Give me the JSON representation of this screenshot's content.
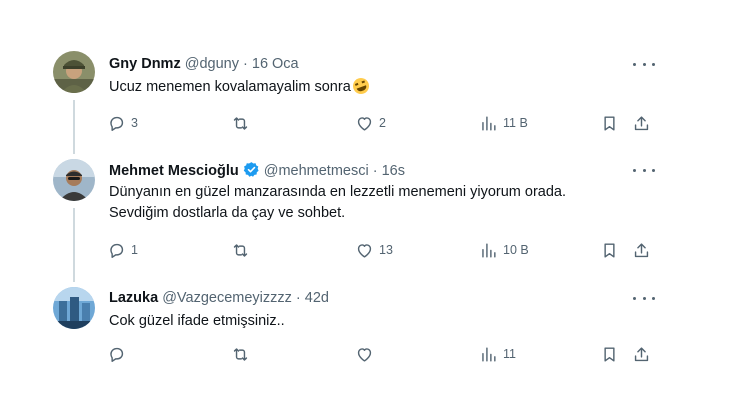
{
  "tweets": [
    {
      "name": "Gny Dnmz",
      "handle": "@dguny",
      "dot": "·",
      "time": "16 Oca",
      "verified": false,
      "text_lines": [
        "Ucuz menemen kovalamayalim sonra"
      ],
      "has_emoji": true,
      "emoji": "rolling-on-floor-laughing",
      "replies": "3",
      "retweets": "",
      "likes": "2",
      "views": "11 B"
    },
    {
      "name": "Mehmet Mescioğlu",
      "handle": "@mehmetmesci",
      "dot": "·",
      "time": "16s",
      "verified": true,
      "text_lines": [
        "Dünyanın en güzel manzarasında en lezzetli menemeni yiyorum orada.",
        "Sevdiğim dostlarla da çay ve sohbet."
      ],
      "replies": "1",
      "retweets": "",
      "likes": "13",
      "views": "10 B"
    },
    {
      "name": "Lazuka",
      "handle": "@Vazgecemeyizzzz",
      "dot": "·",
      "time": "42d",
      "verified": false,
      "text_lines": [
        "Cok güzel ifade etmişsiniz.."
      ],
      "replies": "",
      "retweets": "",
      "likes": "",
      "views": "11"
    }
  ],
  "colors": {
    "secondary_text": "#536471",
    "verified_badge": "#1d9bf0",
    "thread_line": "#cfd9de"
  }
}
